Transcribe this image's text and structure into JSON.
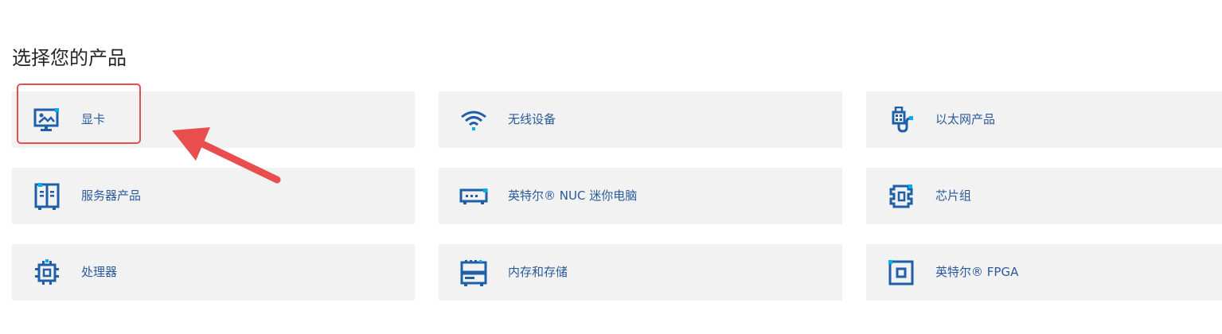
{
  "section": {
    "title": "选择您的产品"
  },
  "products": [
    {
      "label": "显卡",
      "icon": "graphics-card-monitor-icon"
    },
    {
      "label": "无线设备",
      "icon": "wifi-icon"
    },
    {
      "label": "以太网产品",
      "icon": "ethernet-plug-icon"
    },
    {
      "label": "服务器产品",
      "icon": "server-icon"
    },
    {
      "label": "英特尔® NUC 迷你电脑",
      "icon": "nuc-mini-pc-icon"
    },
    {
      "label": "芯片组",
      "icon": "chipset-icon"
    },
    {
      "label": "处理器",
      "icon": "processor-icon"
    },
    {
      "label": "内存和存储",
      "icon": "memory-storage-icon"
    },
    {
      "label": "英特尔® FPGA",
      "icon": "fpga-icon"
    }
  ],
  "colors": {
    "tile_bg": "#f2f2f2",
    "label": "#2a5a9a",
    "icon_primary": "#1f5fa8",
    "icon_accent": "#00aeef",
    "annotation_red": "#e84e4e"
  }
}
